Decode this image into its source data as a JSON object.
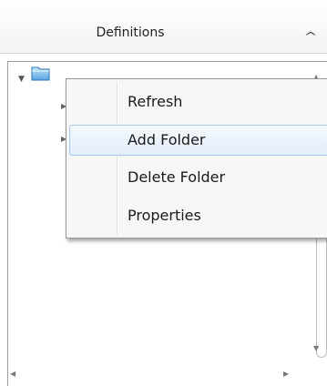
{
  "panel": {
    "title": "Definitions",
    "collapse_glyph": "^"
  },
  "tree": {
    "root_icon": "folder-icon",
    "expand_glyph": "▼",
    "child_glyph": "▶",
    "scroll_up_glyph": "▲",
    "scroll_down_glyph": "▼",
    "scroll_left_glyph": "◀",
    "scroll_right_glyph": "▶"
  },
  "context_menu": {
    "items": [
      {
        "label": "Refresh"
      },
      {
        "label": "Add Folder"
      },
      {
        "label": "Delete Folder"
      },
      {
        "label": "Properties"
      }
    ],
    "highlight_color": "#e4eefb",
    "highlight_border": "#a9c7ef"
  }
}
